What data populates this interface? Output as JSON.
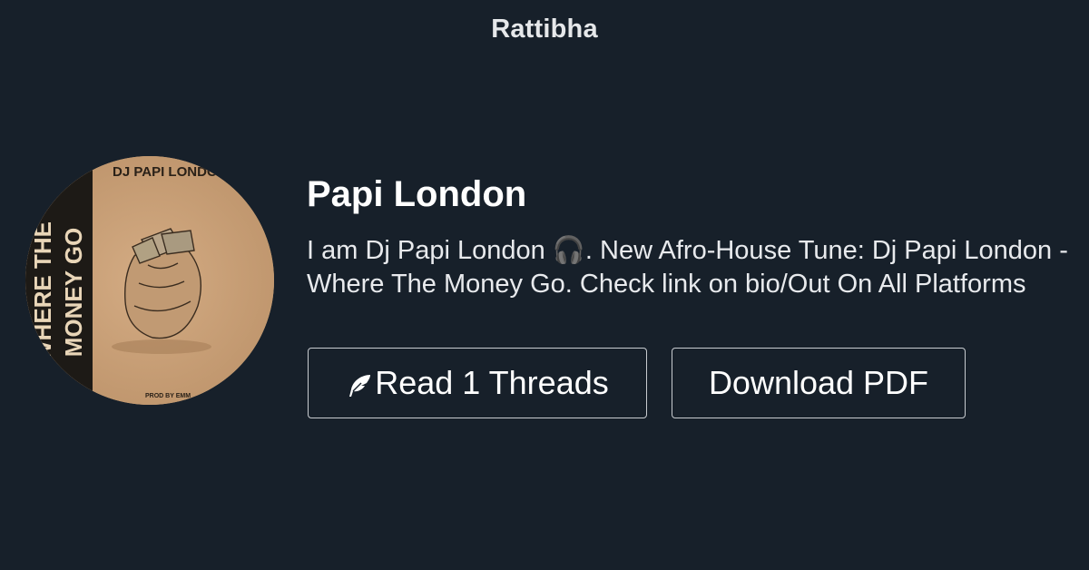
{
  "site": {
    "name": "Rattibha"
  },
  "profile": {
    "name": "Papi London",
    "avatar_alt": "Where The Money Go cover art",
    "cover": {
      "artist": "DJ PAPI LONDON",
      "title_line1": "WHERE THE",
      "title_line2": "MONEY GO",
      "credit": "PROD BY EMM"
    },
    "bio": "I am Dj Papi London 🎧. New Afro-House Tune: Dj Papi London - Where The Money Go. Check link on bio/Out On All Platforms"
  },
  "actions": {
    "read_label": "Read 1 Threads",
    "read_icon": "feather-icon",
    "pdf_label": "Download PDF"
  },
  "colors": {
    "background": "#17202a",
    "text": "#ffffff",
    "button_border": "#c8ccd0"
  }
}
